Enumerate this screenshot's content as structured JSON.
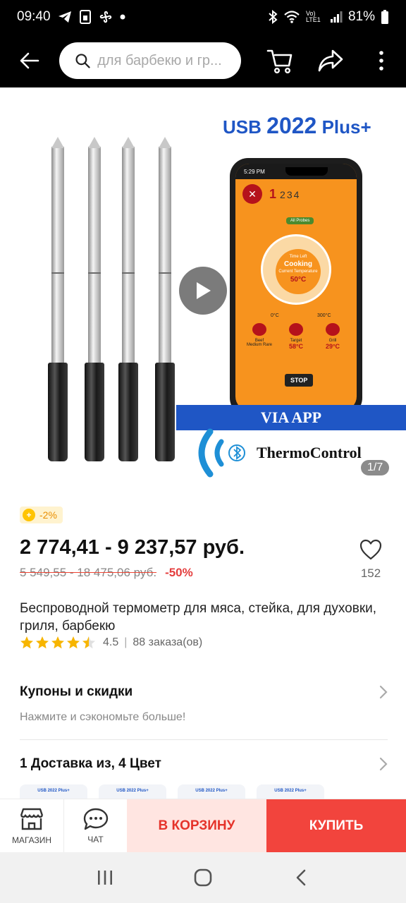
{
  "status_bar": {
    "time": "09:40",
    "battery": "81%",
    "network": "Vo) LTE1"
  },
  "search": {
    "placeholder": "для барбекю и гр..."
  },
  "gallery": {
    "promo_prefix": "USB",
    "promo_year": "2022",
    "promo_suffix": "Plus+",
    "via_app": "VIA APP",
    "brand": "ThermoControl",
    "counter": "1/7",
    "app": {
      "clock": "5:29 PM",
      "probe_active": "1",
      "probe_others": "234",
      "all_probes": "All Probes",
      "time_left": "Time Left",
      "state": "Cooking",
      "current_temp_label": "Current Temperature",
      "current_temp": "50°C",
      "dial_min": "0°C",
      "dial_max": "300°C",
      "cells": [
        {
          "label": "Beef\nMedium Rare",
          "value": ""
        },
        {
          "label": "Target",
          "value": "58°C"
        },
        {
          "label": "Grill",
          "value": "29°C"
        }
      ],
      "stop": "STOP"
    }
  },
  "product": {
    "discount_badge": "-2%",
    "price": "2 774,41 - 9 237,57 руб.",
    "old_price": "5 549,55 - 18 475,06 руб.",
    "discount_pct": "-50%",
    "wishlist_count": "152",
    "title": "Беспроводной термометр для мяса, стейка, для духовки, гриля, барбекю",
    "rating": "4.5",
    "rating_value": 4.5,
    "orders": "88 заказа(ов)"
  },
  "coupons": {
    "title": "Купоны и скидки",
    "subtitle": "Нажмите и сэкономьте больше!"
  },
  "delivery": {
    "title": "1 Доставка из, 4 Цвет"
  },
  "variants": [
    "USB 2022 Plus+",
    "USB 2022 Plus+",
    "USB 2022 Plus+",
    "USB 2022 Plus+"
  ],
  "action_bar": {
    "shop": "МАГАЗИН",
    "chat": "ЧАТ",
    "add_to_cart": "В КОРЗИНУ",
    "buy": "КУПИТЬ"
  },
  "colors": {
    "accent_red": "#f2443d",
    "cart_bg": "#ffe5e1",
    "brand_blue": "#1f56c5",
    "star": "#f7b500"
  }
}
